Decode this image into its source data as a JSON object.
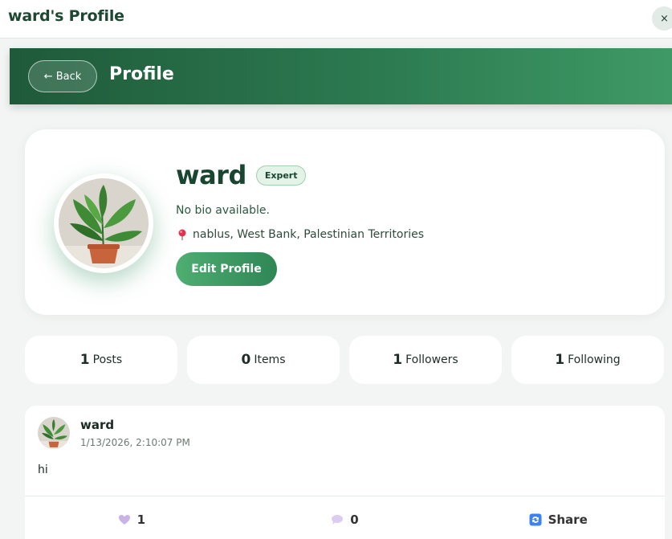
{
  "modal": {
    "title": "ward's Profile",
    "close_label": "×"
  },
  "hero": {
    "back_label": "← Back",
    "title": "Profile"
  },
  "profile": {
    "name": "ward",
    "badge": "Expert",
    "bio": "No bio available.",
    "location": "nablus, West Bank, Palestinian Territories",
    "edit_label": "Edit Profile"
  },
  "stats": [
    {
      "count": "1",
      "label": "Posts"
    },
    {
      "count": "0",
      "label": "Items"
    },
    {
      "count": "1",
      "label": "Followers"
    },
    {
      "count": "1",
      "label": "Following"
    }
  ],
  "post": {
    "author": "ward",
    "timestamp": "1/13/2026, 2:10:07 PM",
    "body": "hi",
    "likes": "1",
    "comments": "0",
    "share_label": "Share"
  },
  "icons": {
    "pin": "location-pin-icon",
    "heart": "heart-icon",
    "comment": "comment-icon",
    "share": "share-icon"
  },
  "colors": {
    "brand_dark": "#1d4731",
    "brand_gradient_start": "#1f5a3a",
    "brand_gradient_end": "#3f9a66",
    "badge_bg": "#e4f3e8",
    "button_green": "#4fae72",
    "pin_red": "#e0334d",
    "heart_purple": "#c9b3e6",
    "share_blue": "#3b82f6"
  }
}
